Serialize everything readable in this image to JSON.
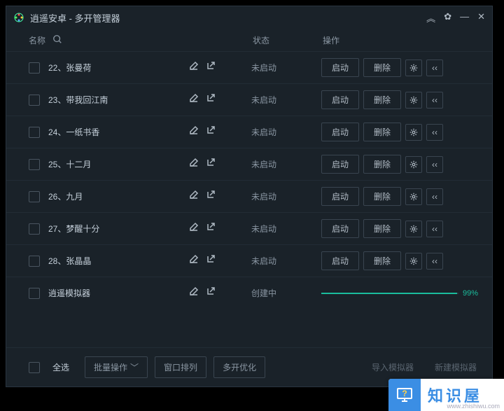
{
  "titlebar": {
    "title": "逍遥安卓 - 多开管理器"
  },
  "header": {
    "name": "名称",
    "status": "状态",
    "action": "操作"
  },
  "rows": [
    {
      "name": "22、张曼荷",
      "status": "未启动",
      "start": "启动",
      "delete": "删除",
      "type": "normal"
    },
    {
      "name": "23、带我回江南",
      "status": "未启动",
      "start": "启动",
      "delete": "删除",
      "type": "normal"
    },
    {
      "name": "24、一纸书香",
      "status": "未启动",
      "start": "启动",
      "delete": "删除",
      "type": "normal"
    },
    {
      "name": "25、十二月",
      "status": "未启动",
      "start": "启动",
      "delete": "删除",
      "type": "normal"
    },
    {
      "name": "26、九月",
      "status": "未启动",
      "start": "启动",
      "delete": "删除",
      "type": "normal"
    },
    {
      "name": "27、梦醒十分",
      "status": "未启动",
      "start": "启动",
      "delete": "删除",
      "type": "normal"
    },
    {
      "name": "28、张晶晶",
      "status": "未启动",
      "start": "启动",
      "delete": "删除",
      "type": "normal"
    },
    {
      "name": "逍遥模拟器",
      "status": "创建中",
      "type": "progress",
      "progress": 99,
      "progress_text": "99%"
    }
  ],
  "footer": {
    "select_all": "全选",
    "batch": "批量操作",
    "window_arrange": "窗口排列",
    "multi_optimize": "多开优化",
    "import": "导入模拟器",
    "new": "新建模拟器"
  },
  "watermark": {
    "brand": "知识屋",
    "url": "www.zhishiwu.com"
  }
}
